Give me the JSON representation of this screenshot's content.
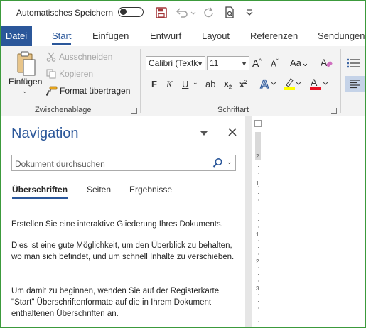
{
  "qat": {
    "autosave_label": "Automatisches Speichern",
    "accent": "#2b579a",
    "save_color": "#a4373a"
  },
  "tabs": [
    {
      "label": "Datei"
    },
    {
      "label": "Start"
    },
    {
      "label": "Einfügen"
    },
    {
      "label": "Entwurf"
    },
    {
      "label": "Layout"
    },
    {
      "label": "Referenzen"
    },
    {
      "label": "Sendungen"
    }
  ],
  "clipboard": {
    "paste_label": "Einfügen",
    "cut_label": "Ausschneiden",
    "copy_label": "Kopieren",
    "format_painter_label": "Format übertragen",
    "group_label": "Zwischenablage"
  },
  "font": {
    "font_name": "Calibri (Textk",
    "font_size": "11",
    "group_label": "Schriftart",
    "highlight_color": "#ffff00",
    "font_color": "#e81123"
  },
  "navigation": {
    "title": "Navigation",
    "search_placeholder": "Dokument durchsuchen",
    "tabs": [
      {
        "label": "Überschriften"
      },
      {
        "label": "Seiten"
      },
      {
        "label": "Ergebnisse"
      }
    ],
    "paragraphs": [
      "Erstellen Sie eine interaktive Gliederung Ihres Dokuments.",
      "Dies ist eine gute Möglichkeit, um den Überblick zu behalten, wo man sich befindet, und um schnell Inhalte zu verschieben.",
      "Um damit zu beginnen, wenden Sie auf der Registerkarte \"Start\" Überschriftenformate auf die in Ihrem Dokument enthaltenen Überschriften an."
    ]
  },
  "ruler": {
    "marks": [
      "2",
      "1",
      "1",
      "2",
      "3"
    ]
  }
}
